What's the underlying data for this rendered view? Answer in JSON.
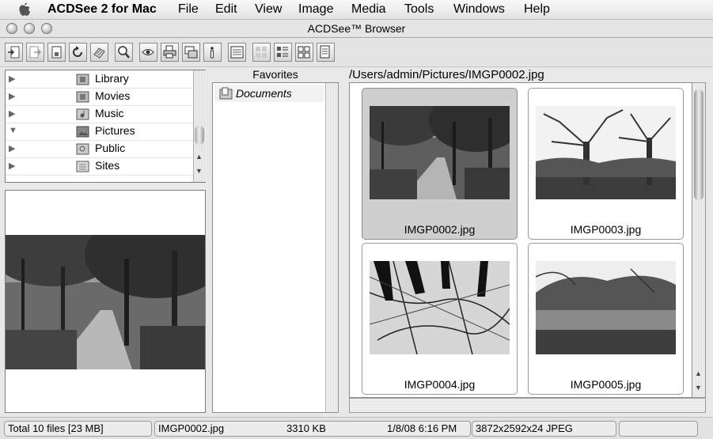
{
  "menubar": {
    "app_name": "ACDSee 2 for Mac",
    "items": [
      "File",
      "Edit",
      "View",
      "Image",
      "Media",
      "Tools",
      "Windows",
      "Help"
    ]
  },
  "window": {
    "title": "ACDSee™ Browser"
  },
  "toolbar": {
    "buttons": [
      "import-icon",
      "export-icon",
      "save-icon",
      "rotate-icon",
      "slideshow-icon",
      "zoom-icon",
      "view-icon",
      "print-icon",
      "batch-convert-icon",
      "info-icon",
      "properties-icon",
      "thumbnails-view-icon",
      "details-view-icon",
      "list-view-icon",
      "text-view-icon"
    ]
  },
  "folders": {
    "items": [
      {
        "label": "Library",
        "expanded": false
      },
      {
        "label": "Movies",
        "expanded": false
      },
      {
        "label": "Music",
        "expanded": false
      },
      {
        "label": "Pictures",
        "expanded": true
      },
      {
        "label": "Public",
        "expanded": false
      },
      {
        "label": "Sites",
        "expanded": false
      }
    ]
  },
  "favorites": {
    "header": "Favorites",
    "items": [
      "Documents"
    ]
  },
  "browser": {
    "path": "/Users/admin/Pictures/IMGP0002.jpg",
    "thumbnails": [
      {
        "filename": "IMGP0002.jpg",
        "selected": true,
        "scene": "forest path"
      },
      {
        "filename": "IMGP0003.jpg",
        "selected": false,
        "scene": "bare trees"
      },
      {
        "filename": "IMGP0004.jpg",
        "selected": false,
        "scene": "branches"
      },
      {
        "filename": "IMGP0005.jpg",
        "selected": false,
        "scene": "pond and trees"
      }
    ]
  },
  "statusbar": {
    "total": "Total 10 files [23 MB]",
    "filename": "IMGP0002.jpg",
    "size": "3310 KB",
    "date": "1/8/08 6:16 PM",
    "dimensions": "3872x2592x24 JPEG"
  },
  "colors": {
    "selected_thumb": "#cfcfcf",
    "window_bg": "#e8e8e8"
  }
}
